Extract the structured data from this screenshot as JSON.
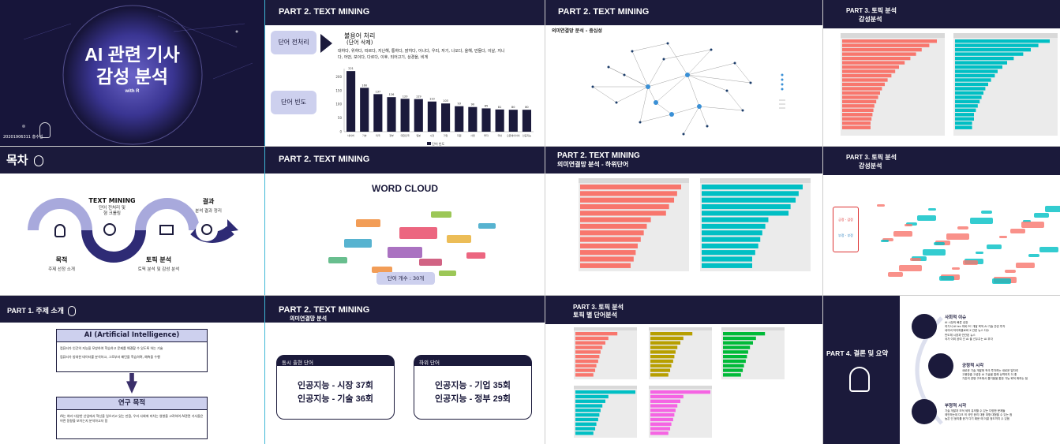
{
  "title_slide": {
    "title_line1": "AI 관련 기사",
    "title_line2": "감성 분석",
    "subtitle": "with R",
    "author": "20201906311 홍수빈"
  },
  "toc": {
    "title": "목차",
    "items": [
      {
        "label": "목적",
        "desc": "주제 선정 소개"
      },
      {
        "label": "TEXT MINING",
        "desc": "단어 전처리 및\n형 크롤링"
      },
      {
        "label": "토픽 분석",
        "desc": "토픽 분석 및 감성 분석"
      },
      {
        "label": "결과",
        "desc": "분석 결과 정리"
      }
    ]
  },
  "part1": {
    "title": "PART 1. 주제 소개",
    "ai_box_title": "AI (Artificial Intelligence)",
    "ai_bullets": [
      "컴퓨터가 인간의 지능을 모방하여 학습하고 문제를 해결할 수 있도록 하는 기술",
      "컴퓨터가 방대한 데이터를 분석하고, 그로부터 패턴을 학습하며, 예측을 수행"
    ],
    "research_title": "연구 목적",
    "research_text": "AI는 여러 다양한 산업에서 혁신을 일으키고 있는 만큼, 우리 사회에 미치는 영향을 고려하여 AI관련 기사들은 어떤 동향을 보이는지 분석하고자 함"
  },
  "tm1": {
    "header": "PART 2. TEXT MINING",
    "btn_preprocess": "단어 전처리",
    "btn_freq": "단어 빈도",
    "stopword_title": "불용어 처리",
    "stopword_sub": "(단어 삭제)",
    "stopword_list": "대하다, 위하다, 따르다, 지난해, 통하다, 밝히다, 어니다, 우리, 자기, 나오다, 올해, 만들다, 이날, 지니다, 어떤, 보이다, 다르다, 이후, 되어고기, 상경을, 비게",
    "legend": "단어 빈도"
  },
  "chart_data": [
    {
      "type": "bar",
      "title": "",
      "categories": [
        "네이버",
        "기술",
        "미국",
        "정부",
        "대한민국",
        "일본",
        "시장",
        "기업",
        "지원",
        "사업",
        "투자",
        "국내",
        "오픈에이아이",
        "인공지능"
      ],
      "values": [
        221,
        160,
        137,
        126,
        120,
        119,
        110,
        103,
        93,
        90,
        85,
        81,
        80,
        80
      ],
      "ylim": [
        0,
        230
      ]
    }
  ],
  "tm2": {
    "header": "PART 2. TEXT MINING",
    "title": "의미연결망 분석 - 중심성"
  },
  "topic1": {
    "header": "PART 3. 토픽 분석",
    "sub": "감성분석"
  },
  "tm3": {
    "header": "PART 2. TEXT MINING",
    "wc_title": "WORD CLOUD",
    "word_count": "단어 개수 : 30개"
  },
  "tm4": {
    "header": "PART 2. TEXT MINING",
    "sub": "의미연결망 분석 - 하위단어"
  },
  "topic2": {
    "header": "PART 3. 토픽 분석",
    "sub": "감성분석",
    "btn1": "긍정 - 감정",
    "btn2": "부정 - 부정"
  },
  "tm5": {
    "header": "PART 2. TEXT MINING",
    "sub": "의미연결망 분석",
    "card1_title": "동시 출현 단어",
    "card1_lines": [
      "인공지능 - 시장 37회",
      "인공지능 - 기술 36회"
    ],
    "card2_title": "하위 단어",
    "card2_lines": [
      "인공지능 - 기업 35회",
      "인공지능 - 정부 29회"
    ]
  },
  "topic3": {
    "header": "PART 3. 토픽 분석",
    "sub": "토픽 별 단어분석"
  },
  "part4": {
    "title": "PART 4. 결론 및 요약",
    "items": [
      {
        "title": "사회적 이슈",
        "text": "AI 시장의 빠른 성장\n여기서 AI tec 미비 PC 개발 목적 AI 기술 관련 투자\n네이버 하이퍼클로바 X 관련 뉴스 다수\n반도체 시장과 연관된 뉴스\n국가 이미 공여 선 AI 을 선두주는 AI 부각"
      },
      {
        "title": "긍정적 시각",
        "text": "새로운 기술 개발에 적극 투자하는 새로운 일자리\n고용창출 고성장 AI 기술을 통해 상역하지 더 좋\n기존의 경쟁 구조에서 즐거움을 통한 가능 혁적 확하는 점"
      },
      {
        "title": "부정적 시각",
        "text": "기술 개발과 도덕 세의 유의할 수 있는 다양한 문제들\n제안하는데 다크 의 국민 윤리 대응 대형 대형을 수 있는 점\n높은 인 윤리를 윤가 다기 때문 에 이끌 정도까지 수 있음"
      }
    ]
  }
}
